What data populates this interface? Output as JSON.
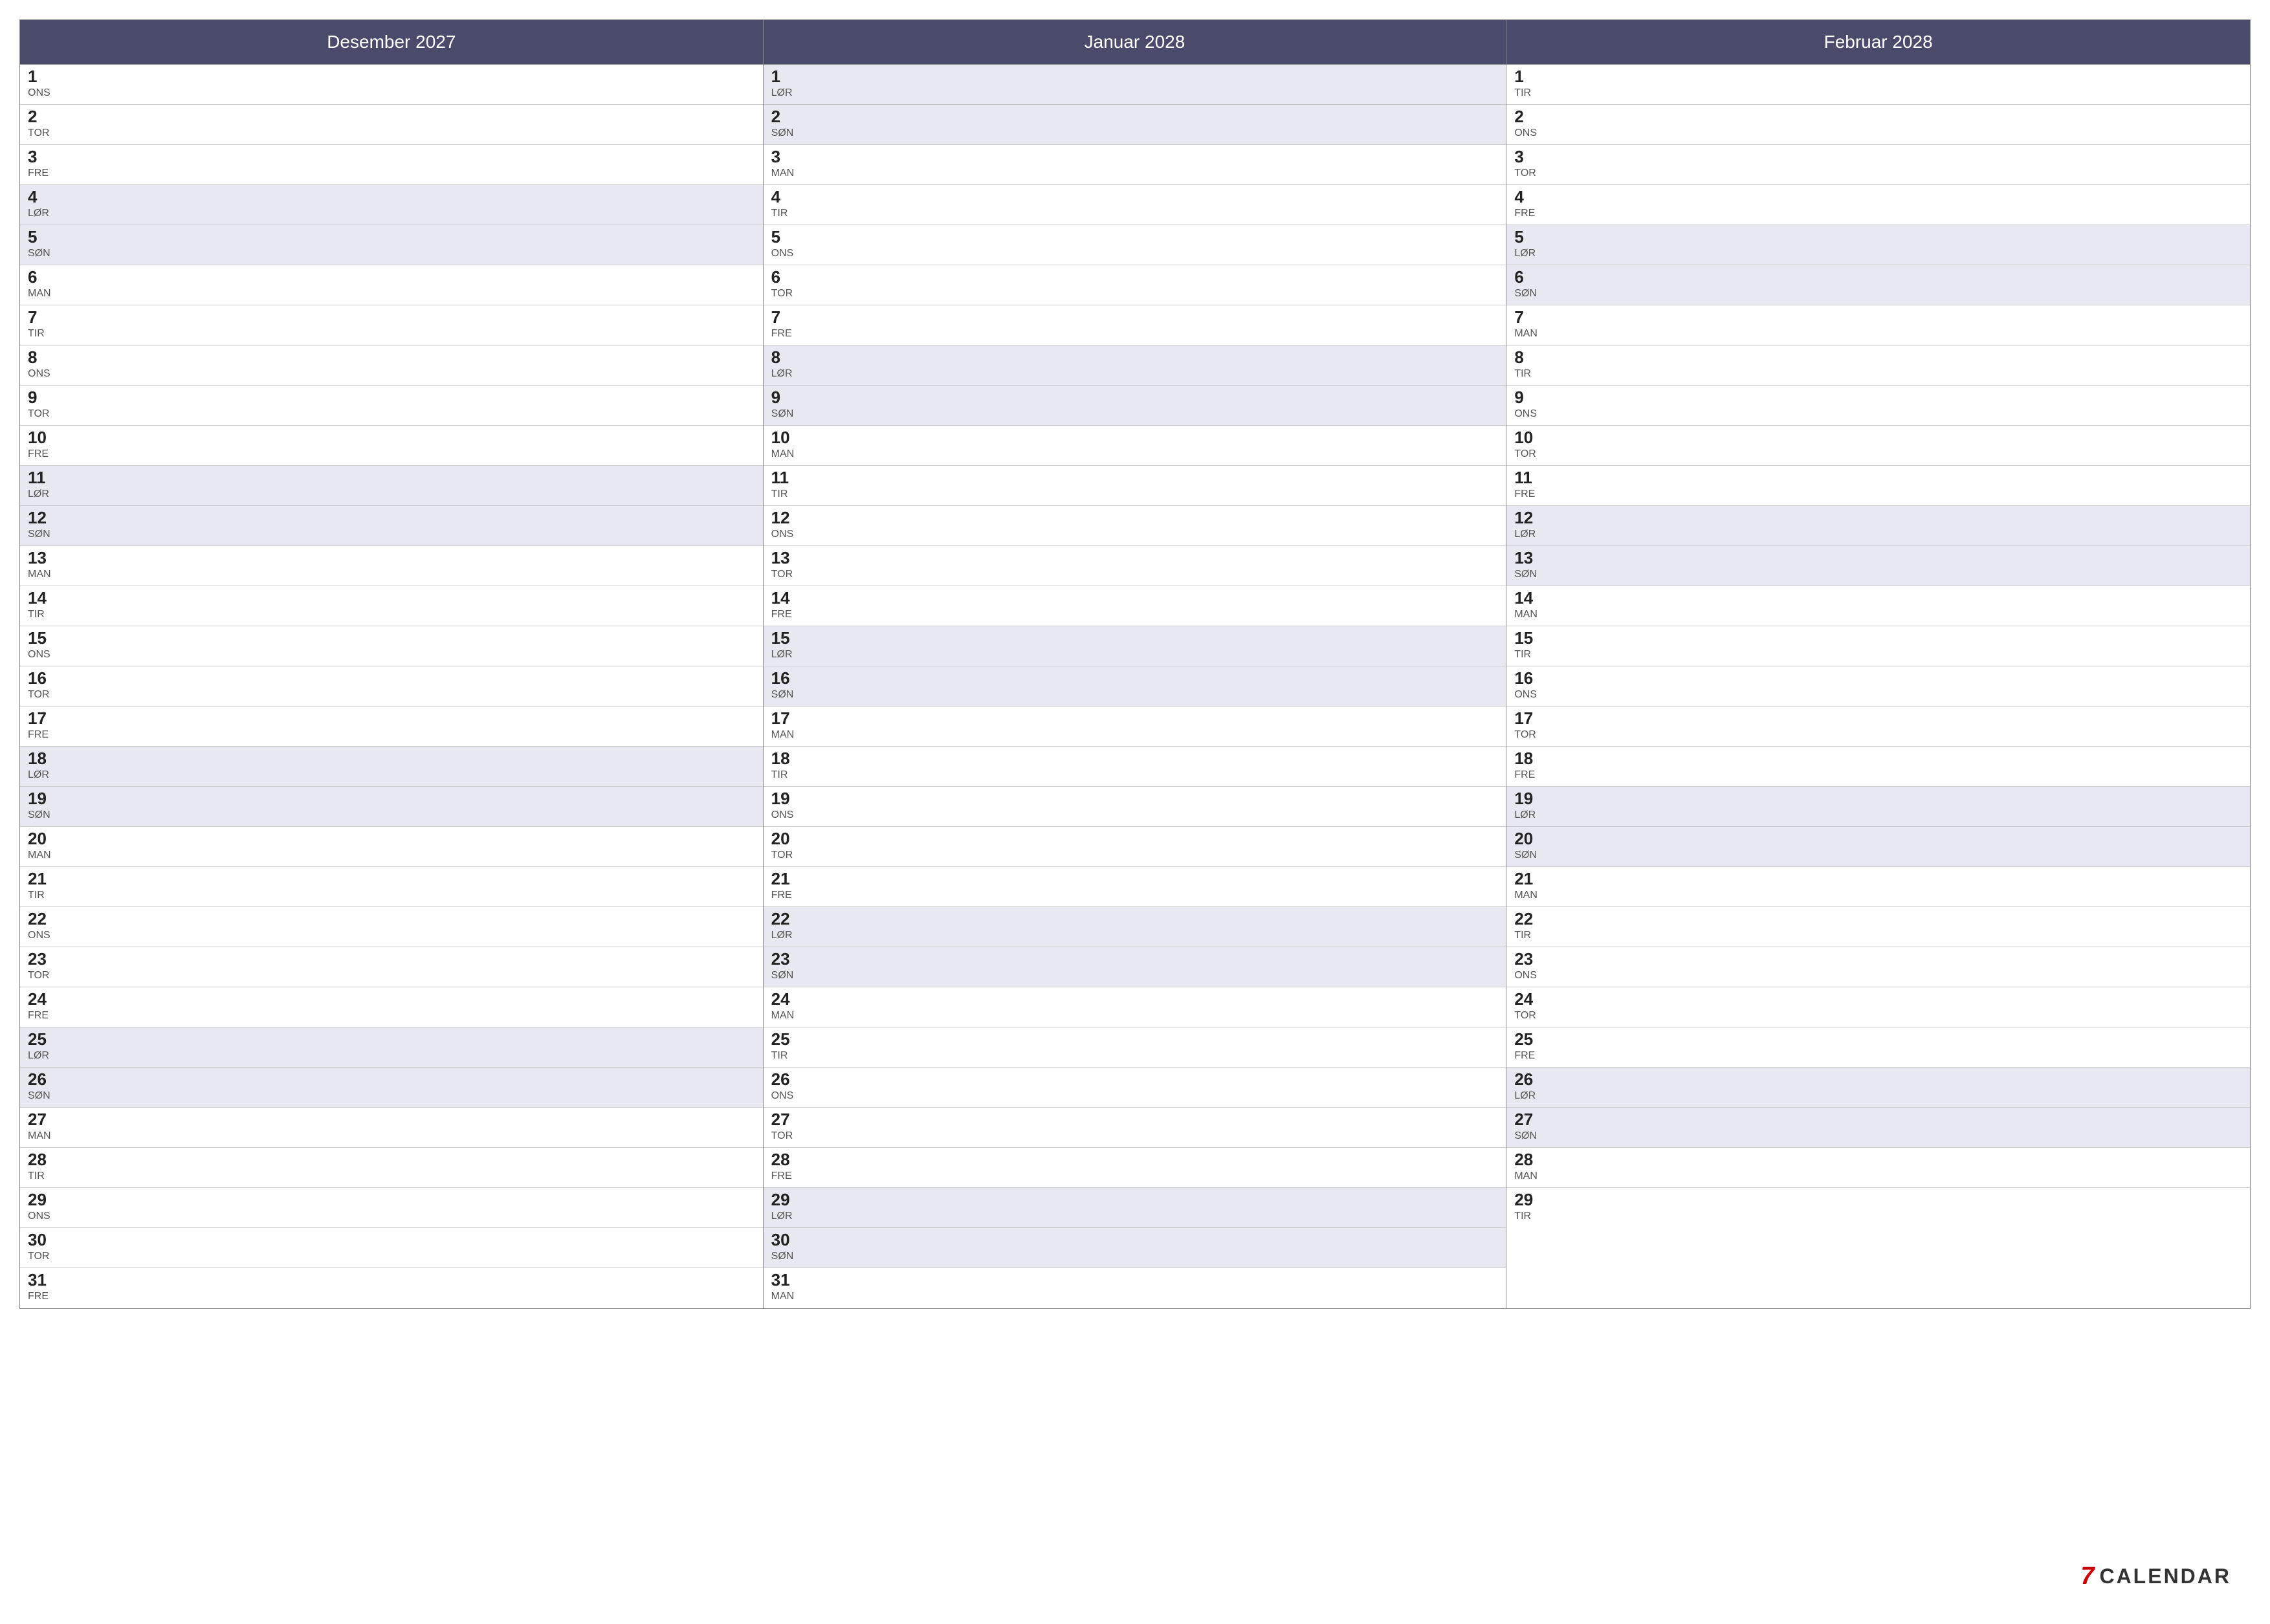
{
  "calendar": {
    "months": [
      {
        "id": "desember-2027",
        "header": "Desember 2027",
        "days": [
          {
            "num": "1",
            "name": "ONS",
            "weekend": false
          },
          {
            "num": "2",
            "name": "TOR",
            "weekend": false
          },
          {
            "num": "3",
            "name": "FRE",
            "weekend": false
          },
          {
            "num": "4",
            "name": "LØR",
            "weekend": true
          },
          {
            "num": "5",
            "name": "SØN",
            "weekend": true
          },
          {
            "num": "6",
            "name": "MAN",
            "weekend": false
          },
          {
            "num": "7",
            "name": "TIR",
            "weekend": false
          },
          {
            "num": "8",
            "name": "ONS",
            "weekend": false
          },
          {
            "num": "9",
            "name": "TOR",
            "weekend": false
          },
          {
            "num": "10",
            "name": "FRE",
            "weekend": false
          },
          {
            "num": "11",
            "name": "LØR",
            "weekend": true
          },
          {
            "num": "12",
            "name": "SØN",
            "weekend": true
          },
          {
            "num": "13",
            "name": "MAN",
            "weekend": false
          },
          {
            "num": "14",
            "name": "TIR",
            "weekend": false
          },
          {
            "num": "15",
            "name": "ONS",
            "weekend": false
          },
          {
            "num": "16",
            "name": "TOR",
            "weekend": false
          },
          {
            "num": "17",
            "name": "FRE",
            "weekend": false
          },
          {
            "num": "18",
            "name": "LØR",
            "weekend": true
          },
          {
            "num": "19",
            "name": "SØN",
            "weekend": true
          },
          {
            "num": "20",
            "name": "MAN",
            "weekend": false
          },
          {
            "num": "21",
            "name": "TIR",
            "weekend": false
          },
          {
            "num": "22",
            "name": "ONS",
            "weekend": false
          },
          {
            "num": "23",
            "name": "TOR",
            "weekend": false
          },
          {
            "num": "24",
            "name": "FRE",
            "weekend": false
          },
          {
            "num": "25",
            "name": "LØR",
            "weekend": true
          },
          {
            "num": "26",
            "name": "SØN",
            "weekend": true
          },
          {
            "num": "27",
            "name": "MAN",
            "weekend": false
          },
          {
            "num": "28",
            "name": "TIR",
            "weekend": false
          },
          {
            "num": "29",
            "name": "ONS",
            "weekend": false
          },
          {
            "num": "30",
            "name": "TOR",
            "weekend": false
          },
          {
            "num": "31",
            "name": "FRE",
            "weekend": false
          }
        ]
      },
      {
        "id": "januar-2028",
        "header": "Januar 2028",
        "days": [
          {
            "num": "1",
            "name": "LØR",
            "weekend": true
          },
          {
            "num": "2",
            "name": "SØN",
            "weekend": true
          },
          {
            "num": "3",
            "name": "MAN",
            "weekend": false
          },
          {
            "num": "4",
            "name": "TIR",
            "weekend": false
          },
          {
            "num": "5",
            "name": "ONS",
            "weekend": false
          },
          {
            "num": "6",
            "name": "TOR",
            "weekend": false
          },
          {
            "num": "7",
            "name": "FRE",
            "weekend": false
          },
          {
            "num": "8",
            "name": "LØR",
            "weekend": true
          },
          {
            "num": "9",
            "name": "SØN",
            "weekend": true
          },
          {
            "num": "10",
            "name": "MAN",
            "weekend": false
          },
          {
            "num": "11",
            "name": "TIR",
            "weekend": false
          },
          {
            "num": "12",
            "name": "ONS",
            "weekend": false
          },
          {
            "num": "13",
            "name": "TOR",
            "weekend": false
          },
          {
            "num": "14",
            "name": "FRE",
            "weekend": false
          },
          {
            "num": "15",
            "name": "LØR",
            "weekend": true
          },
          {
            "num": "16",
            "name": "SØN",
            "weekend": true
          },
          {
            "num": "17",
            "name": "MAN",
            "weekend": false
          },
          {
            "num": "18",
            "name": "TIR",
            "weekend": false
          },
          {
            "num": "19",
            "name": "ONS",
            "weekend": false
          },
          {
            "num": "20",
            "name": "TOR",
            "weekend": false
          },
          {
            "num": "21",
            "name": "FRE",
            "weekend": false
          },
          {
            "num": "22",
            "name": "LØR",
            "weekend": true
          },
          {
            "num": "23",
            "name": "SØN",
            "weekend": true
          },
          {
            "num": "24",
            "name": "MAN",
            "weekend": false
          },
          {
            "num": "25",
            "name": "TIR",
            "weekend": false
          },
          {
            "num": "26",
            "name": "ONS",
            "weekend": false
          },
          {
            "num": "27",
            "name": "TOR",
            "weekend": false
          },
          {
            "num": "28",
            "name": "FRE",
            "weekend": false
          },
          {
            "num": "29",
            "name": "LØR",
            "weekend": true
          },
          {
            "num": "30",
            "name": "SØN",
            "weekend": true
          },
          {
            "num": "31",
            "name": "MAN",
            "weekend": false
          }
        ]
      },
      {
        "id": "februar-2028",
        "header": "Februar 2028",
        "days": [
          {
            "num": "1",
            "name": "TIR",
            "weekend": false
          },
          {
            "num": "2",
            "name": "ONS",
            "weekend": false
          },
          {
            "num": "3",
            "name": "TOR",
            "weekend": false
          },
          {
            "num": "4",
            "name": "FRE",
            "weekend": false
          },
          {
            "num": "5",
            "name": "LØR",
            "weekend": true
          },
          {
            "num": "6",
            "name": "SØN",
            "weekend": true
          },
          {
            "num": "7",
            "name": "MAN",
            "weekend": false
          },
          {
            "num": "8",
            "name": "TIR",
            "weekend": false
          },
          {
            "num": "9",
            "name": "ONS",
            "weekend": false
          },
          {
            "num": "10",
            "name": "TOR",
            "weekend": false
          },
          {
            "num": "11",
            "name": "FRE",
            "weekend": false
          },
          {
            "num": "12",
            "name": "LØR",
            "weekend": true
          },
          {
            "num": "13",
            "name": "SØN",
            "weekend": true
          },
          {
            "num": "14",
            "name": "MAN",
            "weekend": false
          },
          {
            "num": "15",
            "name": "TIR",
            "weekend": false
          },
          {
            "num": "16",
            "name": "ONS",
            "weekend": false
          },
          {
            "num": "17",
            "name": "TOR",
            "weekend": false
          },
          {
            "num": "18",
            "name": "FRE",
            "weekend": false
          },
          {
            "num": "19",
            "name": "LØR",
            "weekend": true
          },
          {
            "num": "20",
            "name": "SØN",
            "weekend": true
          },
          {
            "num": "21",
            "name": "MAN",
            "weekend": false
          },
          {
            "num": "22",
            "name": "TIR",
            "weekend": false
          },
          {
            "num": "23",
            "name": "ONS",
            "weekend": false
          },
          {
            "num": "24",
            "name": "TOR",
            "weekend": false
          },
          {
            "num": "25",
            "name": "FRE",
            "weekend": false
          },
          {
            "num": "26",
            "name": "LØR",
            "weekend": true
          },
          {
            "num": "27",
            "name": "SØN",
            "weekend": true
          },
          {
            "num": "28",
            "name": "MAN",
            "weekend": false
          },
          {
            "num": "29",
            "name": "TIR",
            "weekend": false
          }
        ]
      }
    ],
    "logo": {
      "seven": "7",
      "text": "CALENDAR"
    }
  }
}
